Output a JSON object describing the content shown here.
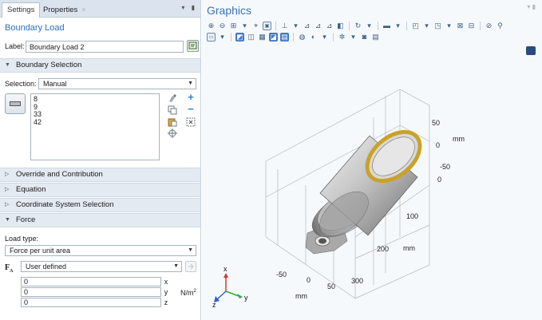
{
  "tabs": {
    "settings": "Settings",
    "properties": "Properties",
    "close": "×",
    "menu": "▾ ▮"
  },
  "node": {
    "title": "Boundary Load"
  },
  "label_field": {
    "label": "Label:",
    "value": "Boundary Load 2"
  },
  "sections": {
    "boundary_selection": "Boundary Selection",
    "override": "Override and Contribution",
    "equation": "Equation",
    "coordinate": "Coordinate System Selection",
    "force": "Force"
  },
  "selection": {
    "label": "Selection:",
    "value": "Manual",
    "items": [
      "8",
      "9",
      "33",
      "42"
    ]
  },
  "load_type": {
    "label": "Load type:",
    "value": "Force per unit area"
  },
  "force": {
    "symbol": "F",
    "symbol_sub": "A",
    "source": "User defined",
    "components": [
      {
        "value": "0",
        "axis": "x"
      },
      {
        "value": "0",
        "axis": "y"
      },
      {
        "value": "0",
        "axis": "z"
      }
    ],
    "unit": "N/m",
    "unit_sup": "2"
  },
  "graphics": {
    "title": "Graphics",
    "axis_ticks": {
      "vertical": [
        "50",
        "0",
        "-50"
      ],
      "vertical_unit": "mm",
      "depth": [
        "0",
        "100",
        "200",
        "300"
      ],
      "depth_unit": "mm",
      "bottom": [
        "-50",
        "0",
        "50"
      ],
      "bottom_unit": "mm"
    },
    "triad": {
      "x": "x",
      "y": "y",
      "z": "z"
    },
    "colors": {
      "highlight_ring": "#c9a227",
      "body": "#b9b9b9",
      "triad_x": "#e0312f",
      "triad_y": "#2faa3c",
      "triad_z": "#2f5fd0"
    }
  }
}
